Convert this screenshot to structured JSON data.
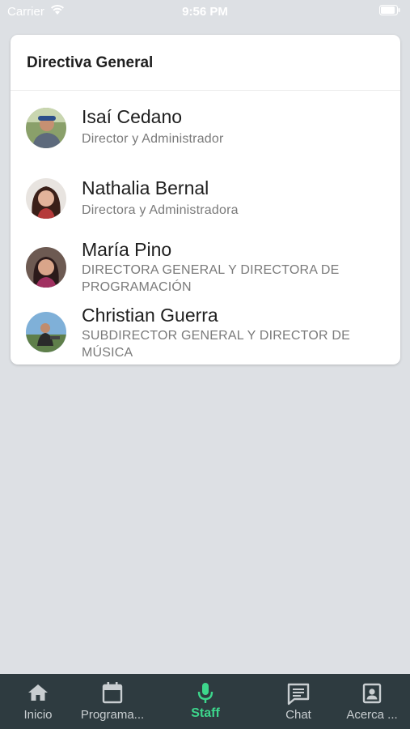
{
  "status_bar": {
    "carrier": "Carrier",
    "time": "9:56 PM"
  },
  "card": {
    "title": "Directiva General",
    "staff": [
      {
        "name": "Isaí Cedano",
        "role": "Director y Administrador"
      },
      {
        "name": "Nathalia Bernal",
        "role": "Directora y Administradora"
      },
      {
        "name": "María Pino",
        "role": "DIRECTORA GENERAL Y DIRECTORA DE PROGRAMACIÓN"
      },
      {
        "name": "Christian Guerra",
        "role": "SUBDIRECTOR GENERAL Y DIRECTOR DE MÚSICA"
      }
    ]
  },
  "tab_bar": {
    "tabs": [
      {
        "label": "Inicio",
        "icon": "home-icon"
      },
      {
        "label": "Programa...",
        "icon": "calendar-icon"
      },
      {
        "label": "Staff",
        "icon": "microphone-icon",
        "active": true
      },
      {
        "label": "Chat",
        "icon": "chat-icon"
      },
      {
        "label": "Acerca ...",
        "icon": "contact-card-icon"
      }
    ],
    "active_color": "#3dd68c",
    "inactive_color": "#c9ced1",
    "background": "#2e3b40"
  }
}
